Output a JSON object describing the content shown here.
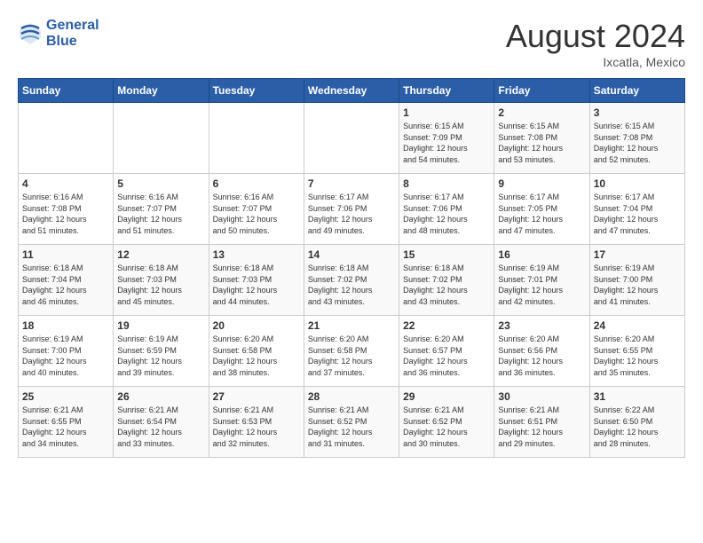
{
  "header": {
    "logo_line1": "General",
    "logo_line2": "Blue",
    "month_year": "August 2024",
    "location": "Ixcatla, Mexico"
  },
  "weekdays": [
    "Sunday",
    "Monday",
    "Tuesday",
    "Wednesday",
    "Thursday",
    "Friday",
    "Saturday"
  ],
  "weeks": [
    [
      {
        "day": "",
        "info": ""
      },
      {
        "day": "",
        "info": ""
      },
      {
        "day": "",
        "info": ""
      },
      {
        "day": "",
        "info": ""
      },
      {
        "day": "1",
        "info": "Sunrise: 6:15 AM\nSunset: 7:09 PM\nDaylight: 12 hours\nand 54 minutes."
      },
      {
        "day": "2",
        "info": "Sunrise: 6:15 AM\nSunset: 7:08 PM\nDaylight: 12 hours\nand 53 minutes."
      },
      {
        "day": "3",
        "info": "Sunrise: 6:15 AM\nSunset: 7:08 PM\nDaylight: 12 hours\nand 52 minutes."
      }
    ],
    [
      {
        "day": "4",
        "info": "Sunrise: 6:16 AM\nSunset: 7:08 PM\nDaylight: 12 hours\nand 51 minutes."
      },
      {
        "day": "5",
        "info": "Sunrise: 6:16 AM\nSunset: 7:07 PM\nDaylight: 12 hours\nand 51 minutes."
      },
      {
        "day": "6",
        "info": "Sunrise: 6:16 AM\nSunset: 7:07 PM\nDaylight: 12 hours\nand 50 minutes."
      },
      {
        "day": "7",
        "info": "Sunrise: 6:17 AM\nSunset: 7:06 PM\nDaylight: 12 hours\nand 49 minutes."
      },
      {
        "day": "8",
        "info": "Sunrise: 6:17 AM\nSunset: 7:06 PM\nDaylight: 12 hours\nand 48 minutes."
      },
      {
        "day": "9",
        "info": "Sunrise: 6:17 AM\nSunset: 7:05 PM\nDaylight: 12 hours\nand 47 minutes."
      },
      {
        "day": "10",
        "info": "Sunrise: 6:17 AM\nSunset: 7:04 PM\nDaylight: 12 hours\nand 47 minutes."
      }
    ],
    [
      {
        "day": "11",
        "info": "Sunrise: 6:18 AM\nSunset: 7:04 PM\nDaylight: 12 hours\nand 46 minutes."
      },
      {
        "day": "12",
        "info": "Sunrise: 6:18 AM\nSunset: 7:03 PM\nDaylight: 12 hours\nand 45 minutes."
      },
      {
        "day": "13",
        "info": "Sunrise: 6:18 AM\nSunset: 7:03 PM\nDaylight: 12 hours\nand 44 minutes."
      },
      {
        "day": "14",
        "info": "Sunrise: 6:18 AM\nSunset: 7:02 PM\nDaylight: 12 hours\nand 43 minutes."
      },
      {
        "day": "15",
        "info": "Sunrise: 6:18 AM\nSunset: 7:02 PM\nDaylight: 12 hours\nand 43 minutes."
      },
      {
        "day": "16",
        "info": "Sunrise: 6:19 AM\nSunset: 7:01 PM\nDaylight: 12 hours\nand 42 minutes."
      },
      {
        "day": "17",
        "info": "Sunrise: 6:19 AM\nSunset: 7:00 PM\nDaylight: 12 hours\nand 41 minutes."
      }
    ],
    [
      {
        "day": "18",
        "info": "Sunrise: 6:19 AM\nSunset: 7:00 PM\nDaylight: 12 hours\nand 40 minutes."
      },
      {
        "day": "19",
        "info": "Sunrise: 6:19 AM\nSunset: 6:59 PM\nDaylight: 12 hours\nand 39 minutes."
      },
      {
        "day": "20",
        "info": "Sunrise: 6:20 AM\nSunset: 6:58 PM\nDaylight: 12 hours\nand 38 minutes."
      },
      {
        "day": "21",
        "info": "Sunrise: 6:20 AM\nSunset: 6:58 PM\nDaylight: 12 hours\nand 37 minutes."
      },
      {
        "day": "22",
        "info": "Sunrise: 6:20 AM\nSunset: 6:57 PM\nDaylight: 12 hours\nand 36 minutes."
      },
      {
        "day": "23",
        "info": "Sunrise: 6:20 AM\nSunset: 6:56 PM\nDaylight: 12 hours\nand 36 minutes."
      },
      {
        "day": "24",
        "info": "Sunrise: 6:20 AM\nSunset: 6:55 PM\nDaylight: 12 hours\nand 35 minutes."
      }
    ],
    [
      {
        "day": "25",
        "info": "Sunrise: 6:21 AM\nSunset: 6:55 PM\nDaylight: 12 hours\nand 34 minutes."
      },
      {
        "day": "26",
        "info": "Sunrise: 6:21 AM\nSunset: 6:54 PM\nDaylight: 12 hours\nand 33 minutes."
      },
      {
        "day": "27",
        "info": "Sunrise: 6:21 AM\nSunset: 6:53 PM\nDaylight: 12 hours\nand 32 minutes."
      },
      {
        "day": "28",
        "info": "Sunrise: 6:21 AM\nSunset: 6:52 PM\nDaylight: 12 hours\nand 31 minutes."
      },
      {
        "day": "29",
        "info": "Sunrise: 6:21 AM\nSunset: 6:52 PM\nDaylight: 12 hours\nand 30 minutes."
      },
      {
        "day": "30",
        "info": "Sunrise: 6:21 AM\nSunset: 6:51 PM\nDaylight: 12 hours\nand 29 minutes."
      },
      {
        "day": "31",
        "info": "Sunrise: 6:22 AM\nSunset: 6:50 PM\nDaylight: 12 hours\nand 28 minutes."
      }
    ]
  ]
}
